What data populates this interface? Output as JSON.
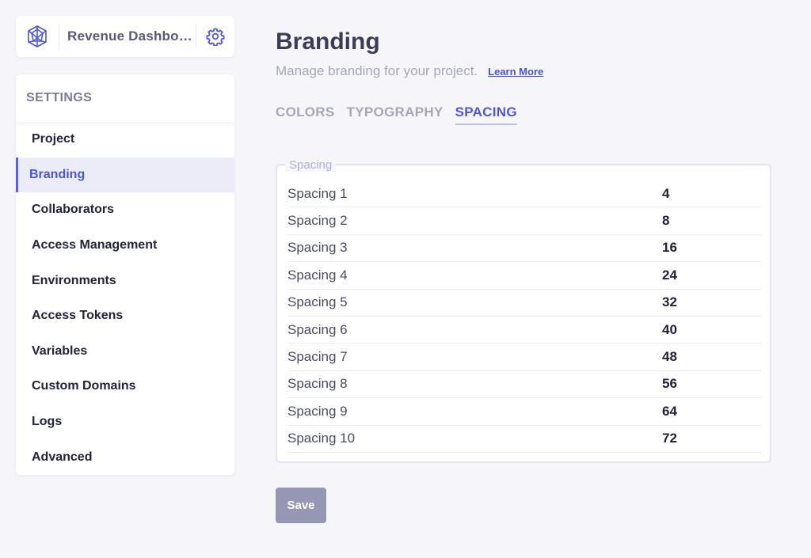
{
  "project": {
    "name": "Revenue Dashbo…",
    "logo_icon": "network-globe-icon",
    "settings_icon": "gear-icon",
    "accent_color": "#4f57d8"
  },
  "sidebar": {
    "header": "SETTINGS",
    "items": [
      {
        "label": "Project"
      },
      {
        "label": "Branding",
        "active": true
      },
      {
        "label": "Collaborators"
      },
      {
        "label": "Access Management"
      },
      {
        "label": "Environments"
      },
      {
        "label": "Access Tokens"
      },
      {
        "label": "Variables"
      },
      {
        "label": "Custom Domains"
      },
      {
        "label": "Logs"
      },
      {
        "label": "Advanced"
      }
    ]
  },
  "main": {
    "title": "Branding",
    "subtitle": "Manage branding for your project.",
    "learn_more": "Learn More",
    "tabs": [
      {
        "label": "COLORS"
      },
      {
        "label": "TYPOGRAPHY"
      },
      {
        "label": "SPACING",
        "active": true
      }
    ],
    "section_legend": "Spacing",
    "rows": [
      {
        "label": "Spacing 1",
        "value": "4"
      },
      {
        "label": "Spacing 2",
        "value": "8"
      },
      {
        "label": "Spacing 3",
        "value": "16"
      },
      {
        "label": "Spacing 4",
        "value": "24"
      },
      {
        "label": "Spacing 5",
        "value": "32"
      },
      {
        "label": "Spacing 6",
        "value": "40"
      },
      {
        "label": "Spacing 7",
        "value": "48"
      },
      {
        "label": "Spacing 8",
        "value": "56"
      },
      {
        "label": "Spacing 9",
        "value": "64"
      },
      {
        "label": "Spacing 10",
        "value": "72"
      }
    ],
    "save_label": "Save"
  }
}
